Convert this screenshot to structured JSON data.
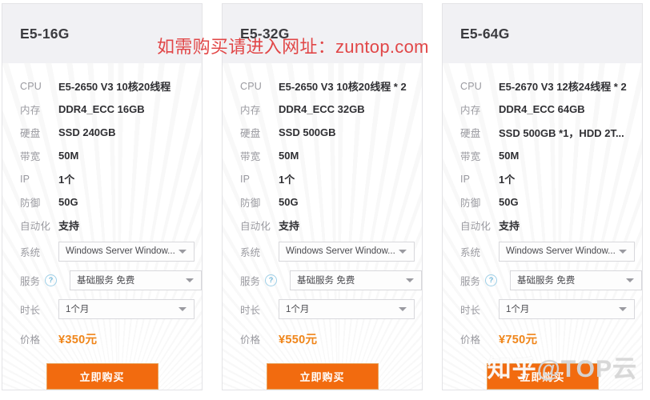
{
  "watermarks": {
    "site_notice": "如需购买请进入网址：zuntop.com",
    "zhihu_prefix": "知乎",
    "zhihu_suffix": "@TOP云"
  },
  "labels": {
    "cpu": "CPU",
    "memory": "内存",
    "disk": "硬盘",
    "bandwidth": "带宽",
    "ip": "IP",
    "defense": "防御",
    "automation": "自动化",
    "system": "系统",
    "service": "服务",
    "duration": "时长",
    "price": "价格",
    "help_icon_glyph": "?"
  },
  "colors": {
    "accent_orange": "#f26b0f",
    "price_orange": "#f08519",
    "watermark_red": "#e03a3a",
    "header_gray": "#f1f1f4",
    "label_gray": "#9a9aa0"
  },
  "buy_label": "立即购买",
  "cards": [
    {
      "title": "E5-16G",
      "cpu": "E5-2650 V3 10核20线程",
      "memory": "DDR4_ECC 16GB",
      "disk": "SSD 240GB",
      "bandwidth": "50M",
      "ip": "1个",
      "defense": "50G",
      "automation": "支持",
      "system": "Windows Server Window...",
      "service": "基础服务 免费",
      "duration": "1个月",
      "price": "¥350元"
    },
    {
      "title": "E5-32G",
      "cpu": "E5-2650 V3 10核20线程 * 2",
      "memory": "DDR4_ECC 32GB",
      "disk": "SSD 500GB",
      "bandwidth": "50M",
      "ip": "1个",
      "defense": "50G",
      "automation": "支持",
      "system": "Windows Server Window...",
      "service": "基础服务 免费",
      "duration": "1个月",
      "price": "¥550元"
    },
    {
      "title": "E5-64G",
      "cpu": "E5-2670 V3 12核24线程 * 2",
      "memory": "DDR4_ECC 64GB",
      "disk": "SSD 500GB *1，HDD 2T...",
      "bandwidth": "50M",
      "ip": "1个",
      "defense": "50G",
      "automation": "支持",
      "system": "Windows Server Window...",
      "service": "基础服务 免费",
      "duration": "1个月",
      "price": "¥750元"
    }
  ]
}
